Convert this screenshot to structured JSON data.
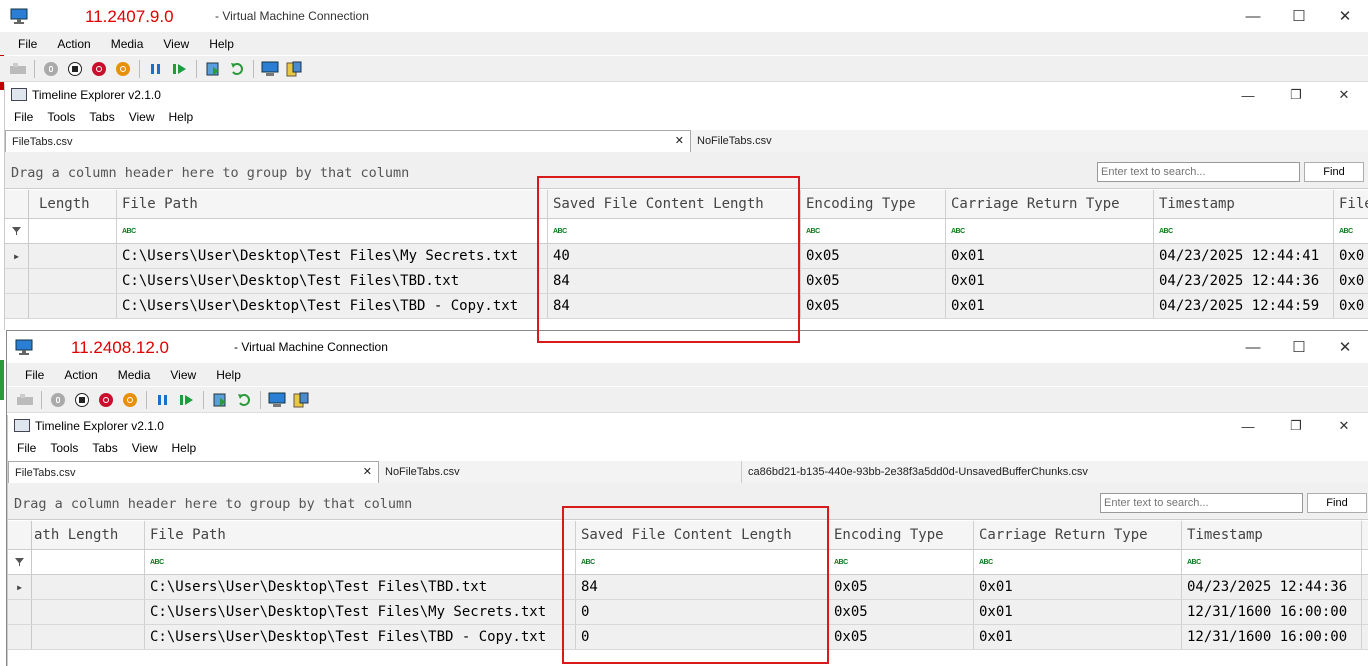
{
  "windows": [
    {
      "version": "11.2407.9.0",
      "title": "- Virtual Machine Connection",
      "menu": [
        "File",
        "Action",
        "Media",
        "View",
        "Help"
      ],
      "app": {
        "title": "Timeline Explorer v2.1.0",
        "menu": [
          "File",
          "Tools",
          "Tabs",
          "View",
          "Help"
        ],
        "tabs": [
          "FileTabs.csv",
          "NoFileTabs.csv"
        ],
        "group_hint": "Drag a column header here to group by that column",
        "search_placeholder": "Enter text to search...",
        "find_label": "Find",
        "columns": [
          "Length",
          "File Path",
          "Saved File Content Length",
          "Encoding Type",
          "Carriage Return Type",
          "Timestamp",
          "File"
        ],
        "rows": [
          [
            "",
            "C:\\Users\\User\\Desktop\\Test Files\\My Secrets.txt",
            "40",
            "0x05",
            "0x01",
            "04/23/2025 12:44:41",
            "0x0"
          ],
          [
            "",
            "C:\\Users\\User\\Desktop\\Test Files\\TBD.txt",
            "84",
            "0x05",
            "0x01",
            "04/23/2025 12:44:36",
            "0x0"
          ],
          [
            "",
            "C:\\Users\\User\\Desktop\\Test Files\\TBD - Copy.txt",
            "84",
            "0x05",
            "0x01",
            "04/23/2025 12:44:59",
            "0x0"
          ]
        ]
      }
    },
    {
      "version": "11.2408.12.0",
      "title": "- Virtual Machine Connection",
      "menu": [
        "File",
        "Action",
        "Media",
        "View",
        "Help"
      ],
      "app": {
        "title": "Timeline Explorer v2.1.0",
        "menu": [
          "File",
          "Tools",
          "Tabs",
          "View",
          "Help"
        ],
        "tabs": [
          "FileTabs.csv",
          "NoFileTabs.csv",
          "ca86bd21-b135-440e-93bb-2e38f3a5dd0d-UnsavedBufferChunks.csv"
        ],
        "group_hint": "Drag a column header here to group by that column",
        "search_placeholder": "Enter text to search...",
        "find_label": "Find",
        "columns": [
          "ath Length",
          "File Path",
          "Saved File Content Length",
          "Encoding Type",
          "Carriage Return Type",
          "Timestamp",
          ""
        ],
        "rows": [
          [
            "",
            "C:\\Users\\User\\Desktop\\Test Files\\TBD.txt",
            "84",
            "0x05",
            "0x01",
            "04/23/2025 12:44:36",
            ""
          ],
          [
            "",
            "C:\\Users\\User\\Desktop\\Test Files\\My Secrets.txt",
            "0",
            "0x05",
            "0x01",
            "12/31/1600 16:00:00",
            ""
          ],
          [
            "",
            "C:\\Users\\User\\Desktop\\Test Files\\TBD - Copy.txt",
            "0",
            "0x05",
            "0x01",
            "12/31/1600 16:00:00",
            ""
          ]
        ]
      }
    }
  ],
  "filter_icon": "abc-filter-icon",
  "colors": {
    "version_text": "#e00000",
    "highlight_box": "#d81a1a"
  }
}
